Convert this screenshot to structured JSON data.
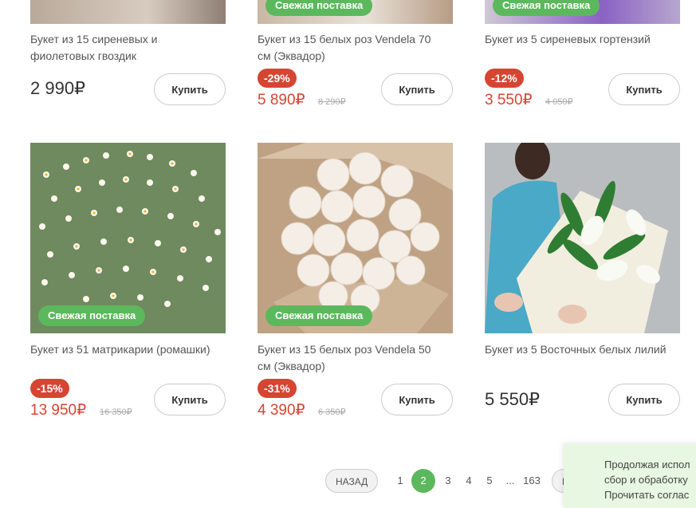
{
  "colors": {
    "accent_green": "#5cb85c",
    "sale_red": "#d64532"
  },
  "products_top": [
    {
      "title": "Букет из 15 сиреневых и фиолетовых гвоздик",
      "price": "2 990₽",
      "discount": "",
      "old_price": "",
      "badge": "",
      "buy": "Купить"
    },
    {
      "title": "Букет из 15 белых роз Vendela 70 см (Эквадор)",
      "price": "5 890₽",
      "discount": "-29%",
      "old_price": "8 290₽",
      "badge": "Свежая поставка",
      "buy": "Купить"
    },
    {
      "title": "Букет из 5 сиреневых гортензий",
      "price": "3 550₽",
      "discount": "-12%",
      "old_price": "4 050₽",
      "badge": "Свежая поставка",
      "buy": "Купить"
    }
  ],
  "products_bottom": [
    {
      "title": "Букет из 51 матрикарии (ромашки)",
      "price": "13 950₽",
      "discount": "-15%",
      "old_price": "16 350₽",
      "badge": "Свежая поставка",
      "buy": "Купить",
      "image": "chamomile bouquet"
    },
    {
      "title": "Букет из 15 белых роз Vendela 50 см (Эквадор)",
      "price": "4 390₽",
      "discount": "-31%",
      "old_price": "6 350₽",
      "badge": "Свежая поставка",
      "buy": "Купить",
      "image": "white roses bouquet"
    },
    {
      "title": "Букет из 5 Восточных белых лилий",
      "price": "5 550₽",
      "discount": "",
      "old_price": "",
      "badge": "",
      "buy": "Купить",
      "image": "white lilies bouquet"
    }
  ],
  "pagination": {
    "prev_label": "НАЗАД",
    "pages": [
      "1",
      "2",
      "3",
      "4",
      "5",
      "...",
      "163"
    ],
    "active": "2",
    "next_label": "В"
  },
  "cookie_notice": {
    "line1": "Продолжая испол",
    "line2": "сбор и обработку",
    "line3": "Прочитать соглас"
  }
}
